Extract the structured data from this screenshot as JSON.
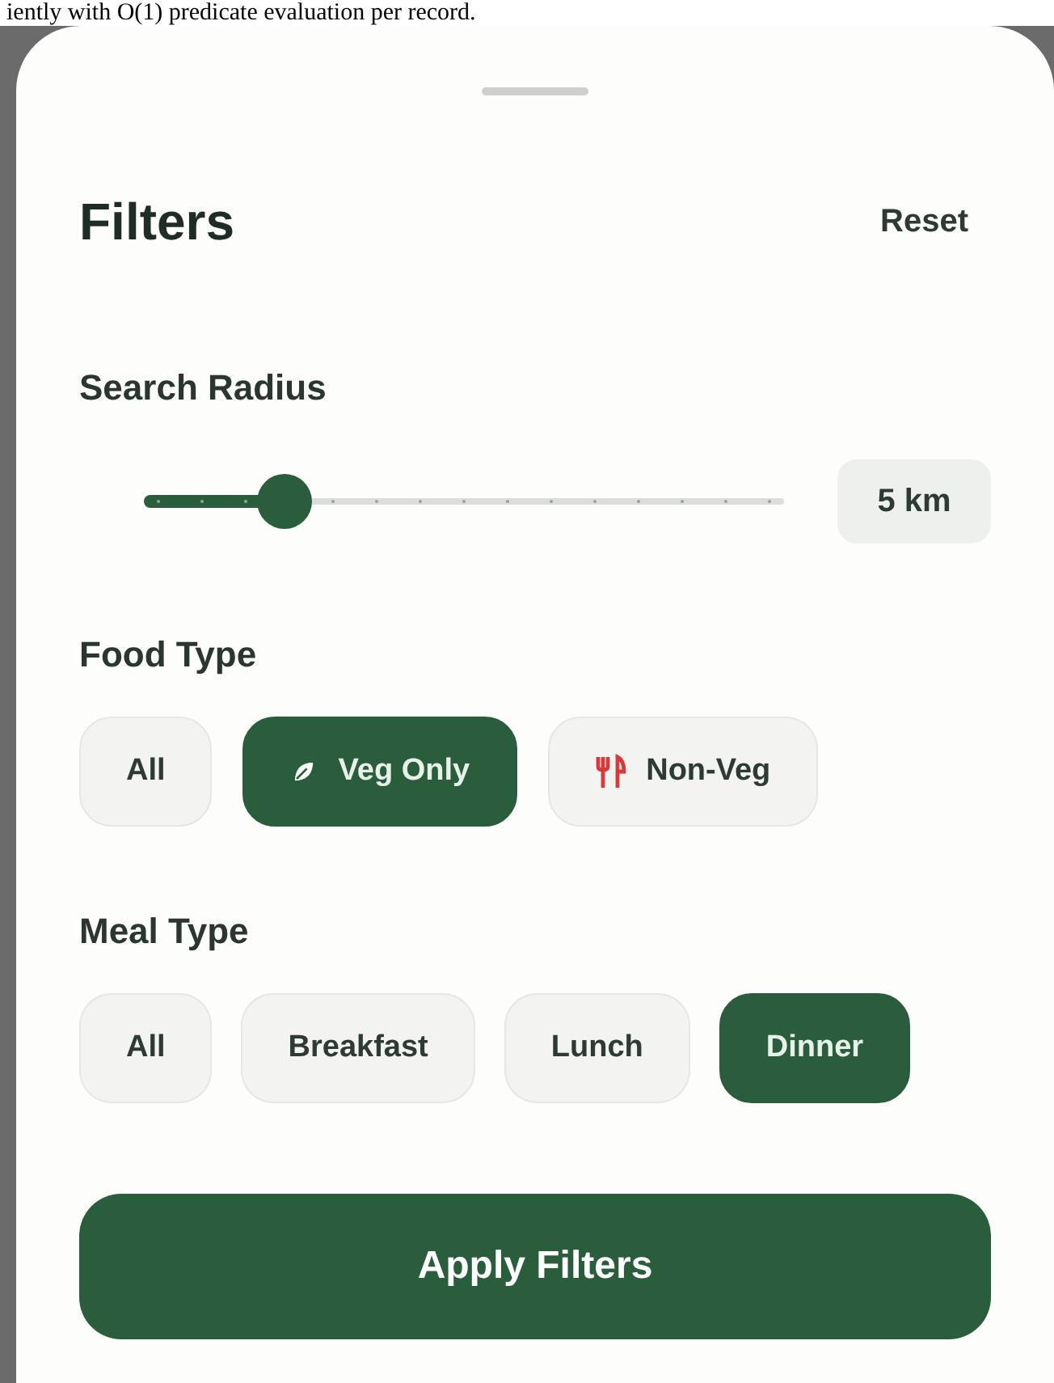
{
  "background_text": "iently with O(1) predicate evaluation per record.",
  "sheet": {
    "title": "Filters",
    "reset": "Reset"
  },
  "radius": {
    "label": "Search Radius",
    "level": 0.22,
    "reading": "5 km"
  },
  "food_type": {
    "label": "Food Type",
    "options": [
      {
        "label": "All",
        "kind": "plain",
        "selected": false
      },
      {
        "label": "Veg Only",
        "kind": "veg",
        "selected": true
      },
      {
        "label": "Non-Veg",
        "kind": "nonveg",
        "selected": false
      }
    ]
  },
  "meal_type": {
    "label": "Meal Type",
    "options": [
      {
        "label": "All",
        "selected": false
      },
      {
        "label": "Breakfast",
        "selected": false
      },
      {
        "label": "Lunch",
        "selected": false
      },
      {
        "label": "Dinner",
        "selected": true
      }
    ]
  },
  "apply_button": "Apply Filters"
}
